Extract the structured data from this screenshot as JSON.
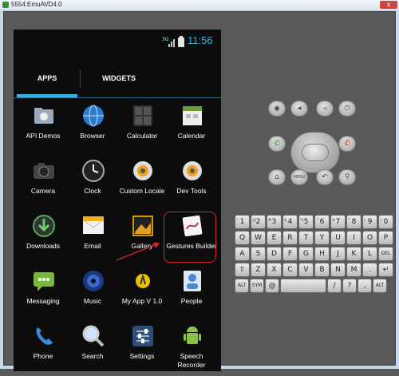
{
  "window": {
    "title": "5554:EmuAVD4.0",
    "close_glyph": "x"
  },
  "status_bar": {
    "network": "3G",
    "time": "11:56"
  },
  "tabs": [
    {
      "label": "APPS"
    },
    {
      "label": "WIDGETS"
    }
  ],
  "apps": [
    {
      "label": "API Demos",
      "icon": "folder-gears-icon"
    },
    {
      "label": "Browser",
      "icon": "globe-icon"
    },
    {
      "label": "Calculator",
      "icon": "calculator-icon"
    },
    {
      "label": "Calendar",
      "icon": "calendar-icon"
    },
    {
      "label": "Camera",
      "icon": "camera-icon"
    },
    {
      "label": "Clock",
      "icon": "clock-icon"
    },
    {
      "label": "Custom Locale",
      "icon": "gear-icon"
    },
    {
      "label": "Dev Tools",
      "icon": "gear-icon"
    },
    {
      "label": "Downloads",
      "icon": "download-icon"
    },
    {
      "label": "Email",
      "icon": "envelope-icon"
    },
    {
      "label": "Gallery",
      "icon": "photo-icon"
    },
    {
      "label": "Gestures Builder",
      "icon": "gesture-icon"
    },
    {
      "label": "Messaging",
      "icon": "chat-bubble-icon"
    },
    {
      "label": "Music",
      "icon": "speaker-icon"
    },
    {
      "label": "My App V 1.0",
      "icon": "android-app-icon"
    },
    {
      "label": "People",
      "icon": "contact-card-icon"
    },
    {
      "label": "Phone",
      "icon": "phone-handset-icon"
    },
    {
      "label": "Search",
      "icon": "magnifier-icon"
    },
    {
      "label": "Settings",
      "icon": "sliders-icon"
    },
    {
      "label": "Speech Recorder",
      "icon": "android-robot-icon"
    }
  ],
  "controls": {
    "top_row": [
      {
        "icon": "camera-icon",
        "glyph": "◉"
      },
      {
        "icon": "volume-down-icon",
        "glyph": "◂"
      },
      {
        "icon": "volume-up-icon",
        "glyph": "◃"
      },
      {
        "icon": "power-icon",
        "glyph": "⏻"
      }
    ],
    "call": "✆",
    "end_call": "✆",
    "bottom_row": [
      {
        "icon": "home-icon",
        "glyph": "⌂"
      },
      {
        "icon": "menu-icon",
        "glyph": "MENU"
      },
      {
        "icon": "back-icon",
        "glyph": "↶"
      },
      {
        "icon": "search-icon",
        "glyph": "⚲"
      }
    ]
  },
  "keyboard": {
    "rows": [
      [
        "1",
        "2",
        "3",
        "4",
        "5",
        "6",
        "7",
        "8",
        "9",
        "0"
      ],
      [
        "Q",
        "W",
        "E",
        "R",
        "T",
        "Y",
        "U",
        "I",
        "O",
        "P"
      ],
      [
        "A",
        "S",
        "D",
        "F",
        "G",
        "H",
        "J",
        "K",
        "L",
        "DEL"
      ],
      [
        "⇧",
        "Z",
        "X",
        "C",
        "V",
        "B",
        "N",
        "M",
        ".",
        "↵"
      ],
      [
        "ALT",
        "SYM",
        "@",
        "",
        "/",
        "?",
        ",",
        "ALT"
      ]
    ],
    "row0_syms": [
      "!",
      "@",
      "#",
      "$",
      "%",
      "^",
      "&",
      "*",
      "(",
      ")"
    ]
  },
  "colors": {
    "accent": "#33b5e5",
    "highlight": "#d62828"
  }
}
